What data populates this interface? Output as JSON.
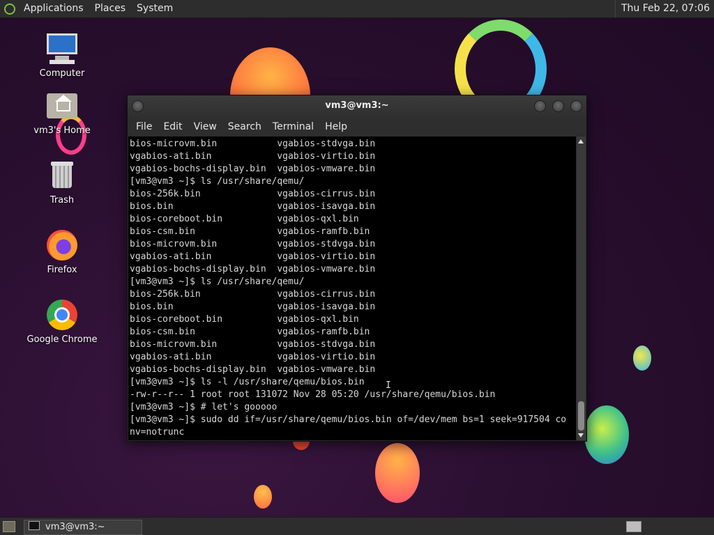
{
  "top_panel": {
    "menus": [
      "Applications",
      "Places",
      "System"
    ],
    "clock": "Thu Feb 22, 07:06"
  },
  "desktop_icons": [
    {
      "label": "Computer",
      "icon": "computer-icon"
    },
    {
      "label": "vm3's Home",
      "icon": "home-folder-icon"
    },
    {
      "label": "Trash",
      "icon": "trash-icon"
    },
    {
      "label": "Firefox",
      "icon": "firefox-icon"
    },
    {
      "label": "Google Chrome",
      "icon": "chrome-icon"
    }
  ],
  "terminal": {
    "title": "vm3@vm3:~",
    "menu": [
      "File",
      "Edit",
      "View",
      "Search",
      "Terminal",
      "Help"
    ],
    "lines": [
      "bios-microvm.bin           vgabios-stdvga.bin",
      "vgabios-ati.bin            vgabios-virtio.bin",
      "vgabios-bochs-display.bin  vgabios-vmware.bin",
      "[vm3@vm3 ~]$ ls /usr/share/qemu/",
      "bios-256k.bin              vgabios-cirrus.bin",
      "bios.bin                   vgabios-isavga.bin",
      "bios-coreboot.bin          vgabios-qxl.bin",
      "bios-csm.bin               vgabios-ramfb.bin",
      "bios-microvm.bin           vgabios-stdvga.bin",
      "vgabios-ati.bin            vgabios-virtio.bin",
      "vgabios-bochs-display.bin  vgabios-vmware.bin",
      "[vm3@vm3 ~]$ ls /usr/share/qemu/",
      "bios-256k.bin              vgabios-cirrus.bin",
      "bios.bin                   vgabios-isavga.bin",
      "bios-coreboot.bin          vgabios-qxl.bin",
      "bios-csm.bin               vgabios-ramfb.bin",
      "bios-microvm.bin           vgabios-stdvga.bin",
      "vgabios-ati.bin            vgabios-virtio.bin",
      "vgabios-bochs-display.bin  vgabios-vmware.bin",
      "[vm3@vm3 ~]$ ls -l /usr/share/qemu/bios.bin",
      "-rw-r--r-- 1 root root 131072 Nov 28 05:20 /usr/share/qemu/bios.bin",
      "[vm3@vm3 ~]$ # let's gooooo",
      "[vm3@vm3 ~]$ sudo dd if=/usr/share/qemu/bios.bin of=/dev/mem bs=1 seek=917504 co",
      "nv=notrunc"
    ]
  },
  "taskbar": {
    "task_label": "vm3@vm3:~"
  }
}
